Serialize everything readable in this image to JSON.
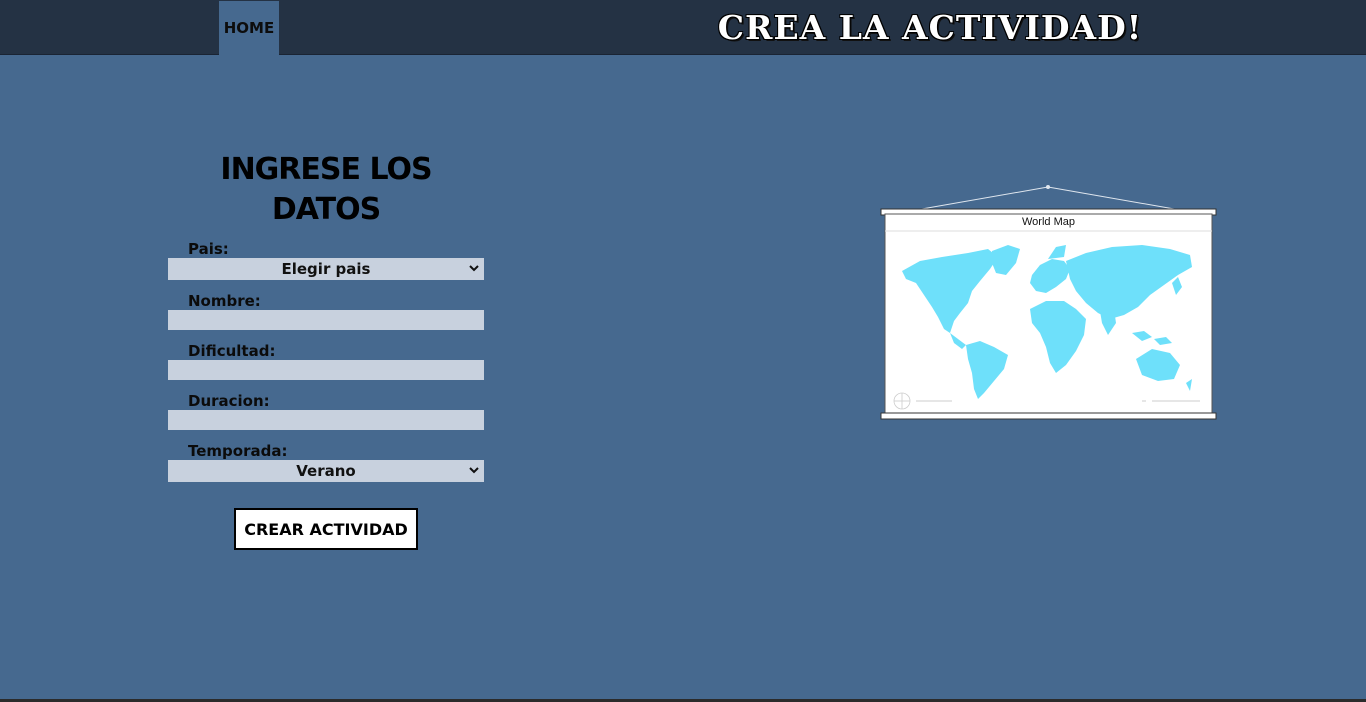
{
  "nav": {
    "home_label": "HOME"
  },
  "header": {
    "title": "CREA LA ACTIVIDAD!"
  },
  "form": {
    "title": "INGRESE LOS DATOS",
    "country": {
      "label": "Pais:",
      "selected": "Elegir pais"
    },
    "name": {
      "label": "Nombre:",
      "value": ""
    },
    "difficulty": {
      "label": "Dificultad:",
      "value": ""
    },
    "duration": {
      "label": "Duracion:",
      "value": ""
    },
    "season": {
      "label": "Temporada:",
      "selected": "Verano"
    },
    "submit_label": "CREAR ACTIVIDAD"
  },
  "map": {
    "title": "World Map"
  },
  "colors": {
    "background": "#46698f",
    "topbar": "#243244",
    "input": "#c8d1de",
    "map_land": "#6ee0fa"
  }
}
